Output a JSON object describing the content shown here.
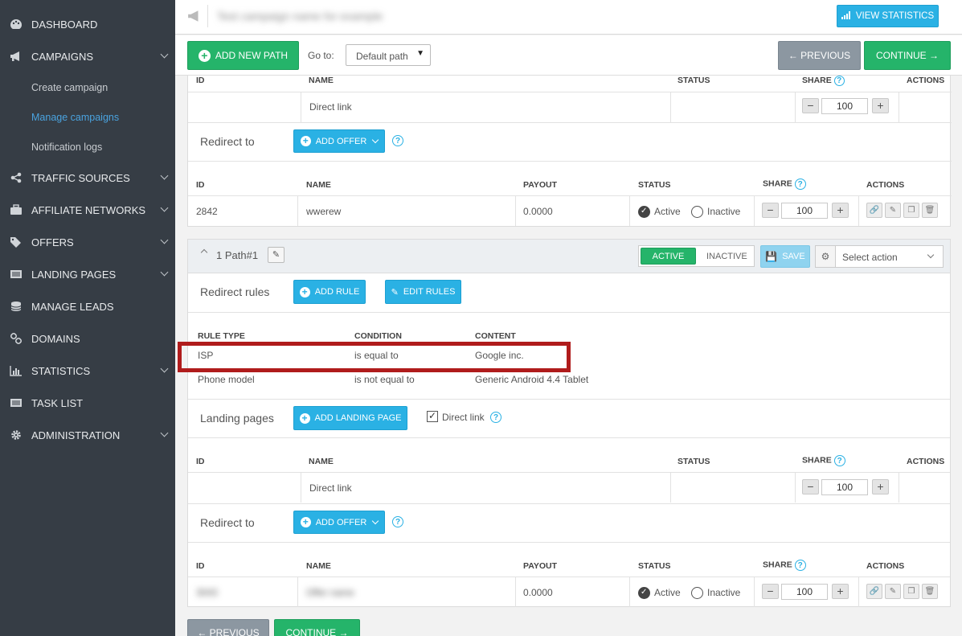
{
  "sidebar": {
    "items": [
      {
        "label": "DASHBOARD",
        "icon": "palette-icon"
      },
      {
        "label": "CAMPAIGNS",
        "icon": "megaphone-icon"
      },
      {
        "label": "TRAFFIC SOURCES",
        "icon": "share-icon"
      },
      {
        "label": "AFFILIATE NETWORKS",
        "icon": "briefcase-icon"
      },
      {
        "label": "OFFERS",
        "icon": "tags-icon"
      },
      {
        "label": "LANDING PAGES",
        "icon": "list-icon"
      },
      {
        "label": "MANAGE LEADS",
        "icon": "database-icon"
      },
      {
        "label": "DOMAINS",
        "icon": "link-icon"
      },
      {
        "label": "STATISTICS",
        "icon": "bar-chart-icon"
      },
      {
        "label": "TASK LIST",
        "icon": "tasks-icon"
      },
      {
        "label": "ADMINISTRATION",
        "icon": "gear-icon"
      }
    ],
    "campaign_sub": [
      "Create campaign",
      "Manage campaigns",
      "Notification logs"
    ]
  },
  "topbar": {
    "campaign_name": "Test campaign name for example",
    "view_statistics": "VIEW STATISTICS"
  },
  "toolbar": {
    "add_new_path": "ADD NEW PATH",
    "goto_label": "Go to:",
    "goto_value": "Default path",
    "previous": "← PREVIOUS",
    "continue": "CONTINUE →"
  },
  "lp_headers": {
    "id": "ID",
    "name": "NAME",
    "status": "STATUS",
    "share": "SHARE",
    "actions": "ACTIONS"
  },
  "offer_headers": {
    "id": "ID",
    "name": "NAME",
    "payout": "PAYOUT",
    "status": "STATUS",
    "share": "SHARE",
    "actions": "ACTIONS"
  },
  "default_path": {
    "lp_row": {
      "name": "Direct link",
      "share": "100"
    },
    "redirect_to": "Redirect to",
    "add_offer": "ADD OFFER",
    "offer_row": {
      "id": "2842",
      "name": "wwerew",
      "payout": "0.0000",
      "active": "Active",
      "inactive": "Inactive",
      "share": "100"
    }
  },
  "path1": {
    "title": "1 Path#1",
    "active": "ACTIVE",
    "inactive": "INACTIVE",
    "save": "SAVE",
    "select_action": "Select action",
    "redirect_rules": "Redirect rules",
    "add_rule": "ADD RULE",
    "edit_rules": "EDIT RULES",
    "rule_headers": {
      "type": "RULE TYPE",
      "condition": "CONDITION",
      "content": "CONTENT"
    },
    "rules": [
      {
        "type": "ISP",
        "condition": "is equal to",
        "content": "Google inc."
      },
      {
        "type": "Phone model",
        "condition": "is not equal to",
        "content": "Generic Android 4.4 Tablet"
      }
    ],
    "landing_pages": "Landing pages",
    "add_landing_page": "ADD LANDING PAGE",
    "direct_link": "Direct link",
    "lp_row": {
      "name": "Direct link",
      "share": "100"
    },
    "redirect_to": "Redirect to",
    "add_offer": "ADD OFFER",
    "offer_row": {
      "id": "3043",
      "name": "Offer name",
      "payout": "0.0000",
      "active": "Active",
      "inactive": "Inactive",
      "share": "100"
    }
  },
  "bottom": {
    "previous": "← PREVIOUS",
    "continue": "CONTINUE →"
  },
  "colors": {
    "sidebar": "#363d45",
    "accent": "#2ab1e4",
    "green": "#25b46a",
    "highlight": "#b01c1c"
  }
}
